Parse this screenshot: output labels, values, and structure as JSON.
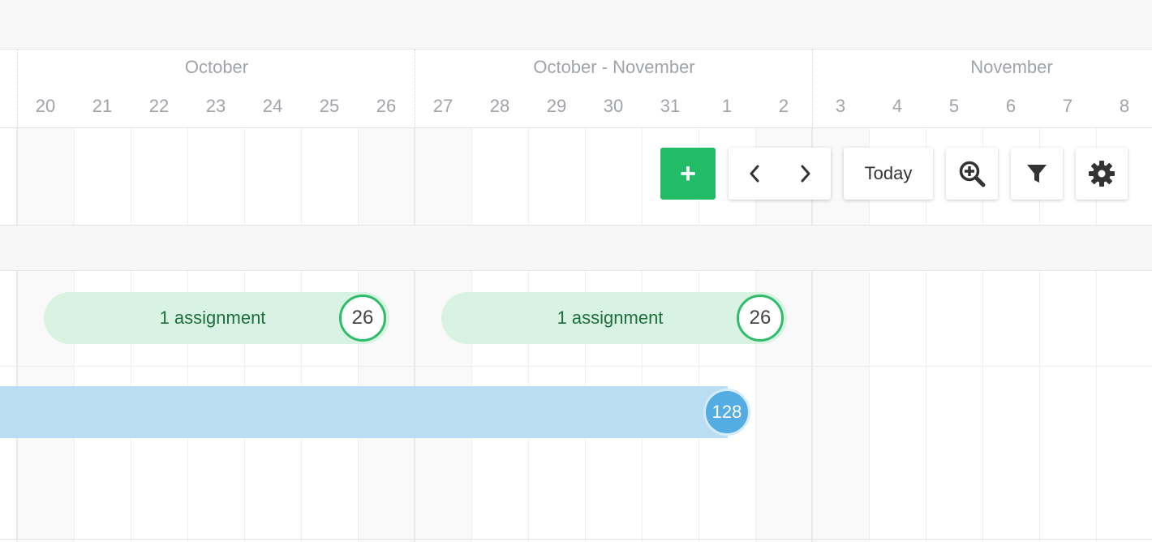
{
  "header": {
    "months": [
      {
        "label": "October"
      },
      {
        "label": "October - November"
      },
      {
        "label": "November"
      }
    ],
    "days": [
      "20",
      "21",
      "22",
      "23",
      "24",
      "25",
      "26",
      "27",
      "28",
      "29",
      "30",
      "31",
      "1",
      "2",
      "3",
      "4",
      "5",
      "6",
      "7",
      "8"
    ]
  },
  "toolbar": {
    "add_label": "+",
    "today_label": "Today",
    "prev_icon": "chevron-left-icon",
    "next_icon": "chevron-right-icon",
    "zoom_icon": "zoom-in-icon",
    "filter_icon": "filter-icon",
    "settings_icon": "gear-icon"
  },
  "assignments": [
    {
      "label": "1 assignment",
      "count": "26"
    },
    {
      "label": "1 assignment",
      "count": "26"
    }
  ],
  "capacity_bar": {
    "count": "128"
  },
  "colors": {
    "accent_green": "#22bb66",
    "assignment_fill": "#d8f2e3",
    "assignment_text": "#1f6e3d",
    "capacity_fill": "#b9def3",
    "capacity_badge": "#55ace2"
  }
}
